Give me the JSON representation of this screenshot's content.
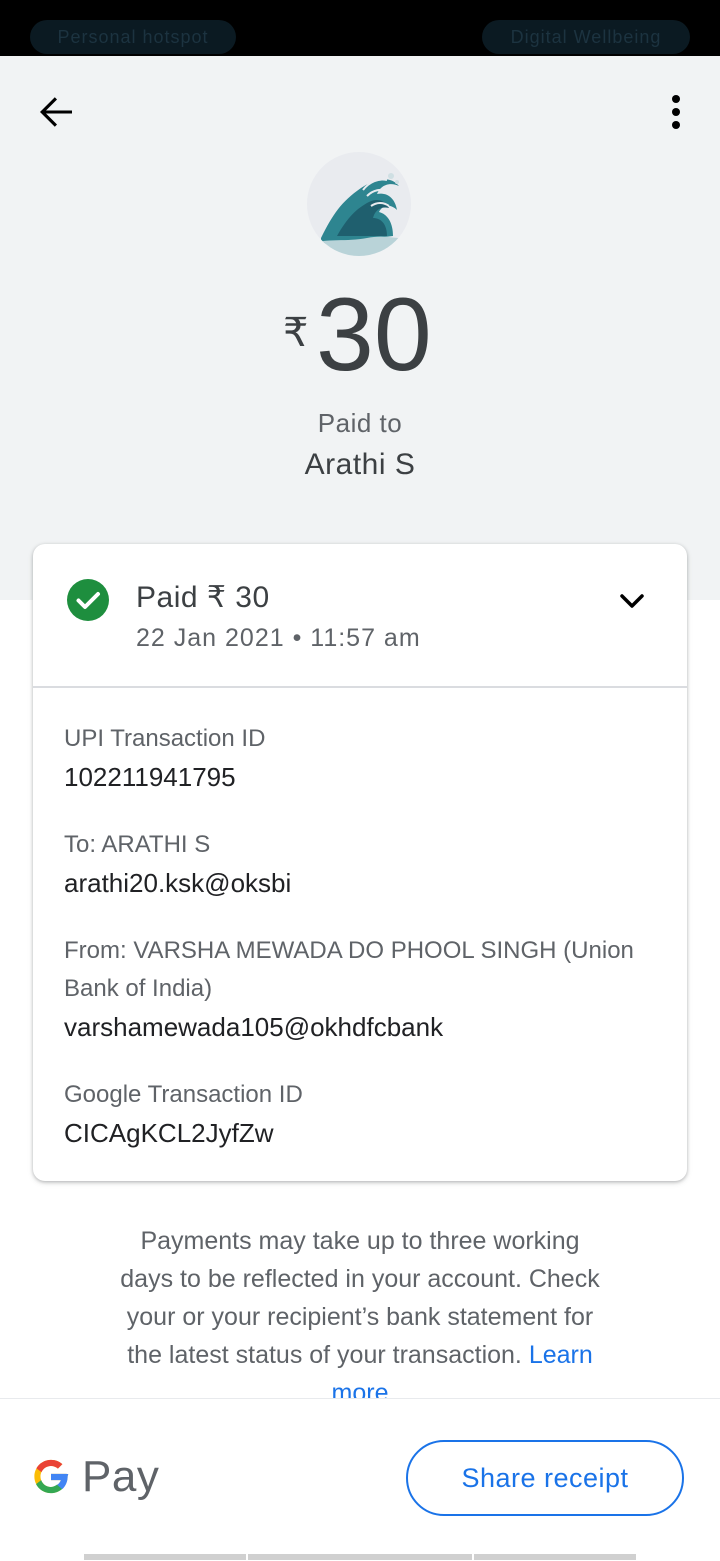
{
  "status_bar": {
    "left_pill": "Personal hotspot",
    "right_pill": "Digital Wellbeing"
  },
  "header": {
    "back_icon": "arrow-back-icon",
    "menu_icon": "more-vert-icon",
    "currency": "₹",
    "amount": "30",
    "paid_to_label": "Paid to",
    "payee_name": "Arathi S"
  },
  "card": {
    "status_icon": "check-circle-icon",
    "status_text": "Paid ₹ 30",
    "datetime": "22 Jan 2021 • 11:57 am",
    "expand_icon": "chevron-down-icon",
    "upi_label": "UPI Transaction ID",
    "upi_value": "102211941795",
    "to_label": "To: ARATHI  S",
    "to_value": "arathi20.ksk@oksbi",
    "from_label": "From: VARSHA MEWADA DO PHOOL SINGH (Union Bank of India)",
    "from_value": "varshamewada105@okhdfcbank",
    "google_label": "Google Transaction ID",
    "google_value": "CICAgKCL2JyfZw"
  },
  "footer": {
    "note": "Payments may take up to three working days to be reflected in your account. Check your or your recipient’s bank statement for the latest status of your transaction.",
    "learn_more": "Learn more"
  },
  "bottom_bar": {
    "brand": "Pay",
    "share_button": "Share receipt"
  },
  "colors": {
    "header_bg": "#f1f3f4",
    "success_green": "#1e8e3e",
    "link_blue": "#1a73e8"
  }
}
